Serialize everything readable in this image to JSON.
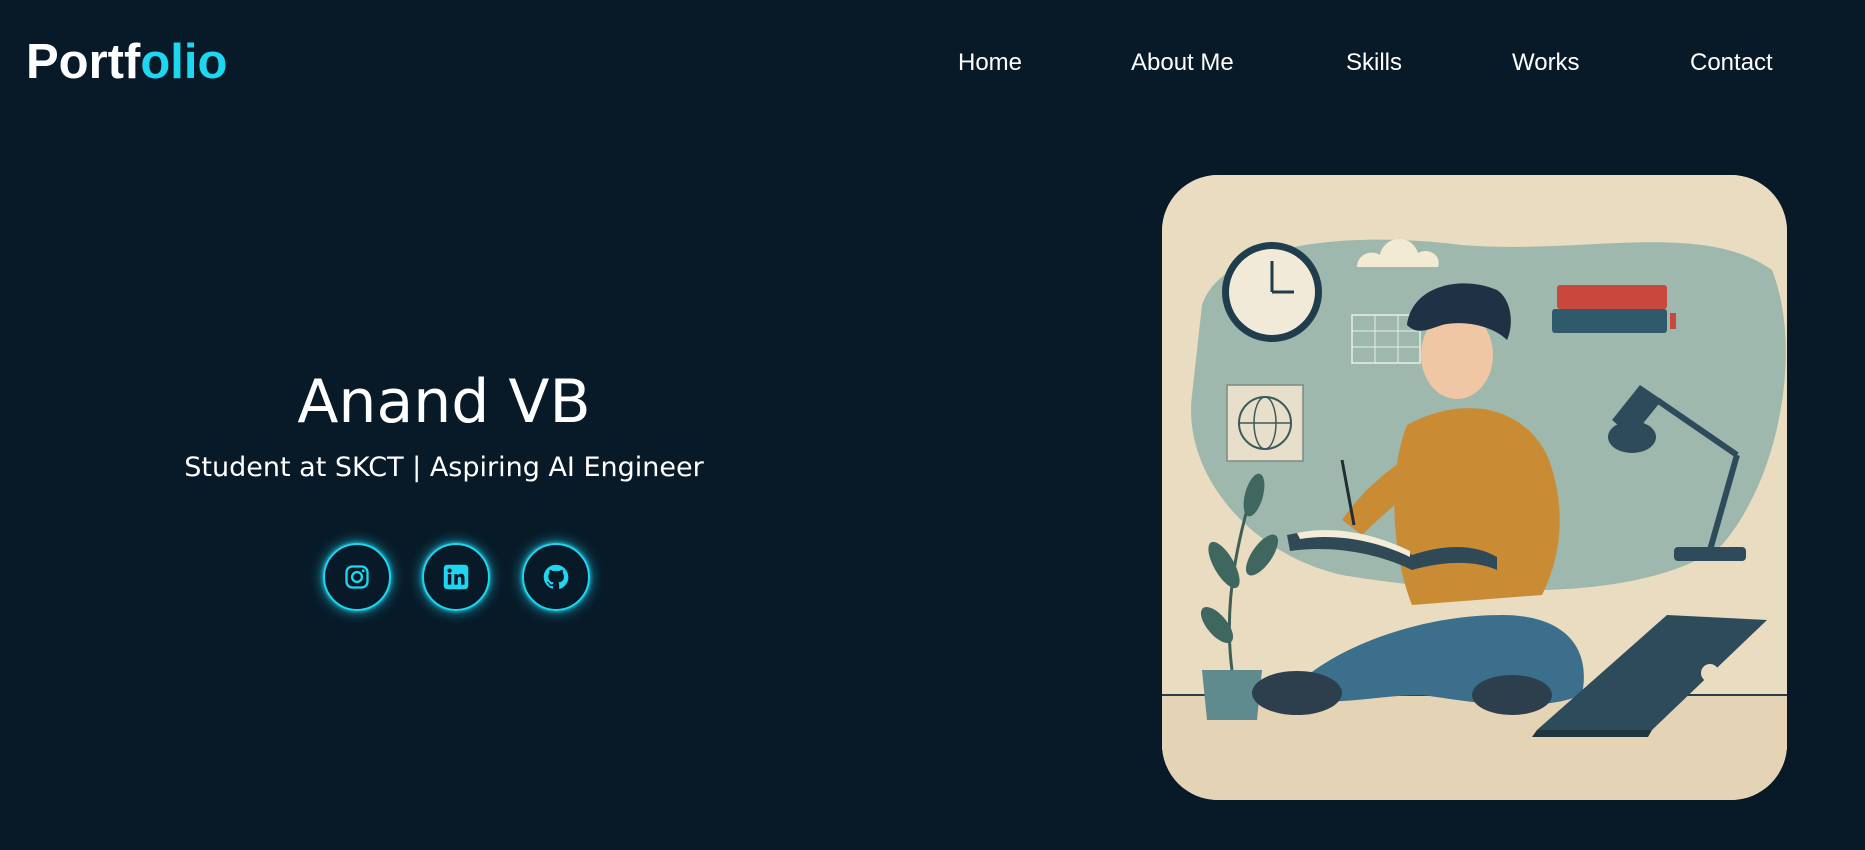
{
  "header": {
    "logo_main": "Portf",
    "logo_accent": "olio",
    "nav": [
      {
        "label": "Home"
      },
      {
        "label": "About Me"
      },
      {
        "label": "Skills"
      },
      {
        "label": "Works"
      },
      {
        "label": "Contact"
      }
    ]
  },
  "hero": {
    "name": "Anand VB",
    "tagline": "Student at SKCT | Aspiring AI Engineer",
    "socials": [
      {
        "icon": "instagram-icon"
      },
      {
        "icon": "linkedin-icon"
      },
      {
        "icon": "github-icon"
      }
    ],
    "illustration": "student-reading-illustration"
  },
  "colors": {
    "background": "#081a28",
    "accent": "#1fd6f0",
    "text": "#ffffff"
  }
}
